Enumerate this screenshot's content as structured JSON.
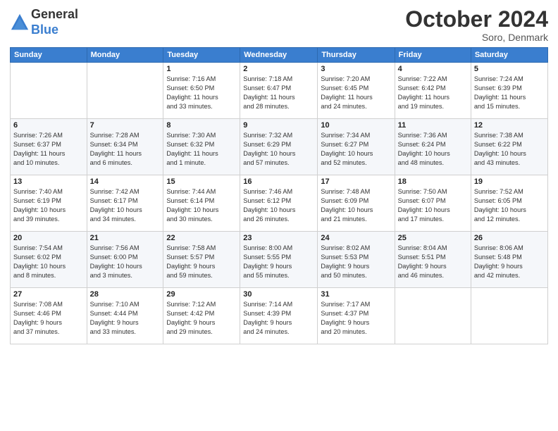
{
  "header": {
    "logo_line1": "General",
    "logo_line2": "Blue",
    "month": "October 2024",
    "location": "Soro, Denmark"
  },
  "weekdays": [
    "Sunday",
    "Monday",
    "Tuesday",
    "Wednesday",
    "Thursday",
    "Friday",
    "Saturday"
  ],
  "weeks": [
    [
      {
        "day": "",
        "info": ""
      },
      {
        "day": "",
        "info": ""
      },
      {
        "day": "1",
        "info": "Sunrise: 7:16 AM\nSunset: 6:50 PM\nDaylight: 11 hours\nand 33 minutes."
      },
      {
        "day": "2",
        "info": "Sunrise: 7:18 AM\nSunset: 6:47 PM\nDaylight: 11 hours\nand 28 minutes."
      },
      {
        "day": "3",
        "info": "Sunrise: 7:20 AM\nSunset: 6:45 PM\nDaylight: 11 hours\nand 24 minutes."
      },
      {
        "day": "4",
        "info": "Sunrise: 7:22 AM\nSunset: 6:42 PM\nDaylight: 11 hours\nand 19 minutes."
      },
      {
        "day": "5",
        "info": "Sunrise: 7:24 AM\nSunset: 6:39 PM\nDaylight: 11 hours\nand 15 minutes."
      }
    ],
    [
      {
        "day": "6",
        "info": "Sunrise: 7:26 AM\nSunset: 6:37 PM\nDaylight: 11 hours\nand 10 minutes."
      },
      {
        "day": "7",
        "info": "Sunrise: 7:28 AM\nSunset: 6:34 PM\nDaylight: 11 hours\nand 6 minutes."
      },
      {
        "day": "8",
        "info": "Sunrise: 7:30 AM\nSunset: 6:32 PM\nDaylight: 11 hours\nand 1 minute."
      },
      {
        "day": "9",
        "info": "Sunrise: 7:32 AM\nSunset: 6:29 PM\nDaylight: 10 hours\nand 57 minutes."
      },
      {
        "day": "10",
        "info": "Sunrise: 7:34 AM\nSunset: 6:27 PM\nDaylight: 10 hours\nand 52 minutes."
      },
      {
        "day": "11",
        "info": "Sunrise: 7:36 AM\nSunset: 6:24 PM\nDaylight: 10 hours\nand 48 minutes."
      },
      {
        "day": "12",
        "info": "Sunrise: 7:38 AM\nSunset: 6:22 PM\nDaylight: 10 hours\nand 43 minutes."
      }
    ],
    [
      {
        "day": "13",
        "info": "Sunrise: 7:40 AM\nSunset: 6:19 PM\nDaylight: 10 hours\nand 39 minutes."
      },
      {
        "day": "14",
        "info": "Sunrise: 7:42 AM\nSunset: 6:17 PM\nDaylight: 10 hours\nand 34 minutes."
      },
      {
        "day": "15",
        "info": "Sunrise: 7:44 AM\nSunset: 6:14 PM\nDaylight: 10 hours\nand 30 minutes."
      },
      {
        "day": "16",
        "info": "Sunrise: 7:46 AM\nSunset: 6:12 PM\nDaylight: 10 hours\nand 26 minutes."
      },
      {
        "day": "17",
        "info": "Sunrise: 7:48 AM\nSunset: 6:09 PM\nDaylight: 10 hours\nand 21 minutes."
      },
      {
        "day": "18",
        "info": "Sunrise: 7:50 AM\nSunset: 6:07 PM\nDaylight: 10 hours\nand 17 minutes."
      },
      {
        "day": "19",
        "info": "Sunrise: 7:52 AM\nSunset: 6:05 PM\nDaylight: 10 hours\nand 12 minutes."
      }
    ],
    [
      {
        "day": "20",
        "info": "Sunrise: 7:54 AM\nSunset: 6:02 PM\nDaylight: 10 hours\nand 8 minutes."
      },
      {
        "day": "21",
        "info": "Sunrise: 7:56 AM\nSunset: 6:00 PM\nDaylight: 10 hours\nand 3 minutes."
      },
      {
        "day": "22",
        "info": "Sunrise: 7:58 AM\nSunset: 5:57 PM\nDaylight: 9 hours\nand 59 minutes."
      },
      {
        "day": "23",
        "info": "Sunrise: 8:00 AM\nSunset: 5:55 PM\nDaylight: 9 hours\nand 55 minutes."
      },
      {
        "day": "24",
        "info": "Sunrise: 8:02 AM\nSunset: 5:53 PM\nDaylight: 9 hours\nand 50 minutes."
      },
      {
        "day": "25",
        "info": "Sunrise: 8:04 AM\nSunset: 5:51 PM\nDaylight: 9 hours\nand 46 minutes."
      },
      {
        "day": "26",
        "info": "Sunrise: 8:06 AM\nSunset: 5:48 PM\nDaylight: 9 hours\nand 42 minutes."
      }
    ],
    [
      {
        "day": "27",
        "info": "Sunrise: 7:08 AM\nSunset: 4:46 PM\nDaylight: 9 hours\nand 37 minutes."
      },
      {
        "day": "28",
        "info": "Sunrise: 7:10 AM\nSunset: 4:44 PM\nDaylight: 9 hours\nand 33 minutes."
      },
      {
        "day": "29",
        "info": "Sunrise: 7:12 AM\nSunset: 4:42 PM\nDaylight: 9 hours\nand 29 minutes."
      },
      {
        "day": "30",
        "info": "Sunrise: 7:14 AM\nSunset: 4:39 PM\nDaylight: 9 hours\nand 24 minutes."
      },
      {
        "day": "31",
        "info": "Sunrise: 7:17 AM\nSunset: 4:37 PM\nDaylight: 9 hours\nand 20 minutes."
      },
      {
        "day": "",
        "info": ""
      },
      {
        "day": "",
        "info": ""
      }
    ]
  ]
}
